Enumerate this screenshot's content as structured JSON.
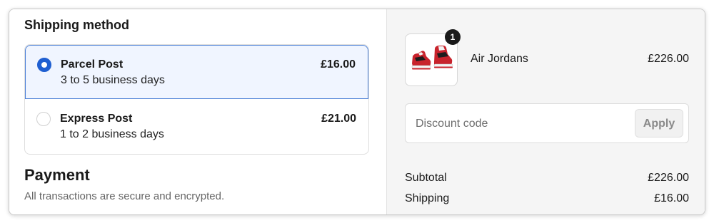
{
  "shipping": {
    "title": "Shipping method",
    "options": [
      {
        "name": "Parcel Post",
        "description": "3 to 5 business days",
        "price": "£16.00",
        "selected": true
      },
      {
        "name": "Express Post",
        "description": "1 to 2 business days",
        "price": "£21.00",
        "selected": false
      }
    ]
  },
  "payment": {
    "title": "Payment",
    "subtitle": "All transactions are secure and encrypted."
  },
  "cart": {
    "item": {
      "name": "Air Jordans",
      "price": "£226.00",
      "quantity_badge": "1",
      "image_icon": "sneakers-image"
    }
  },
  "discount": {
    "placeholder": "Discount code",
    "value": "",
    "apply_label": "Apply"
  },
  "summary": {
    "subtotal_label": "Subtotal",
    "subtotal_value": "£226.00",
    "shipping_label": "Shipping",
    "shipping_value": "£16.00"
  },
  "colors": {
    "accent": "#1f5fd1",
    "selected_bg": "#f0f5ff",
    "sidebar_bg": "#f5f5f5"
  }
}
